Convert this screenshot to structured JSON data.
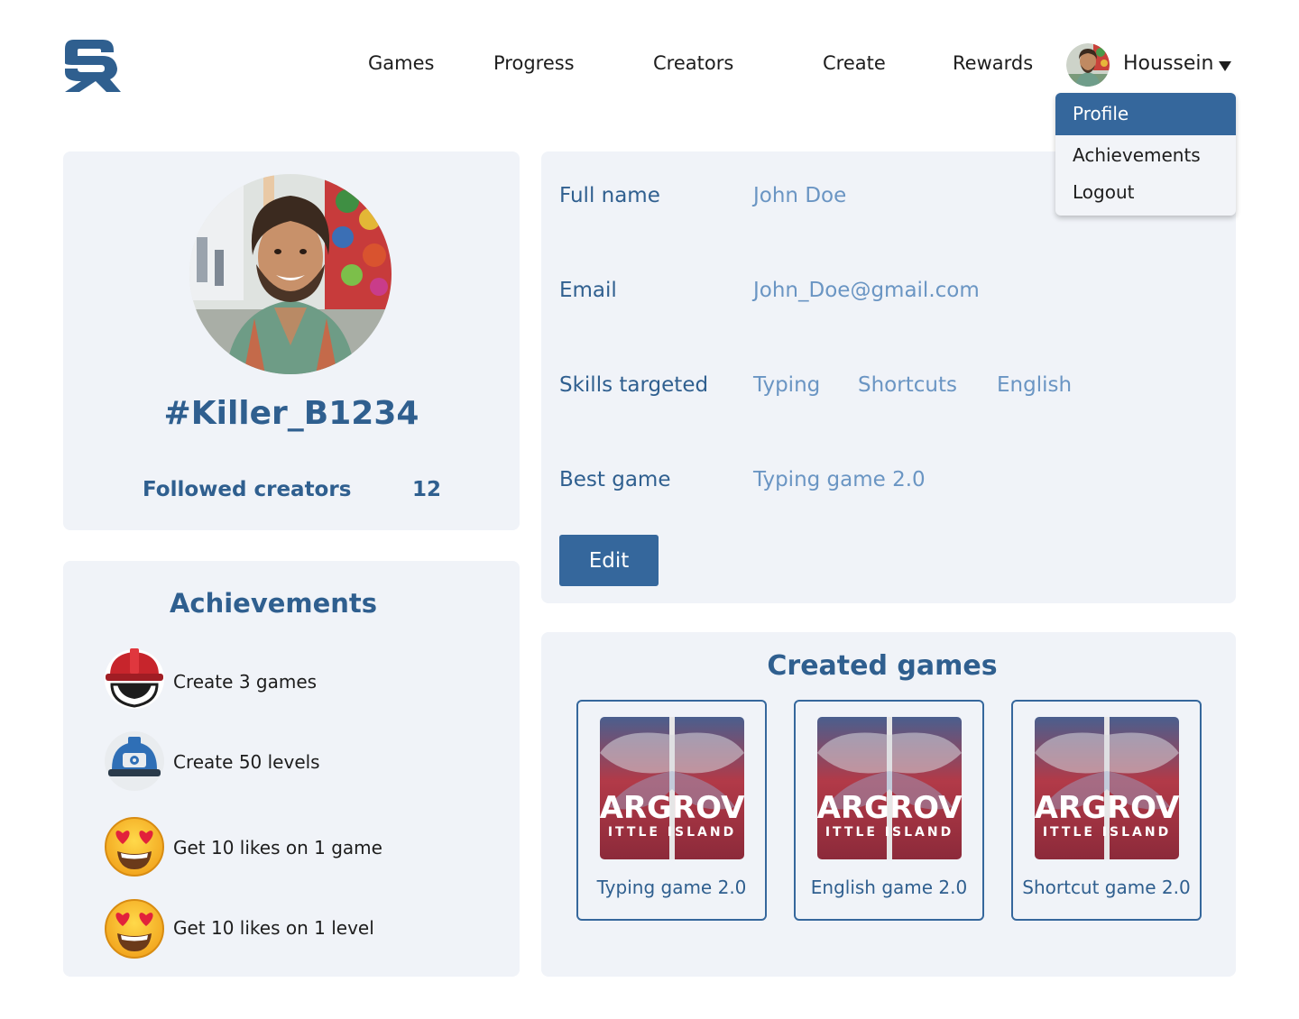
{
  "brand": {
    "logo_text": "SR",
    "logo_color": "#2f5f8f"
  },
  "nav": {
    "games": "Games",
    "progress": "Progress",
    "creators": "Creators",
    "create": "Create",
    "rewards": "Rewards"
  },
  "user_menu": {
    "name": "Houssein",
    "items": [
      "Profile",
      "Achievements",
      "Logout"
    ],
    "active_item": "Profile"
  },
  "profile": {
    "username": "#Killer_B1234",
    "followed_label": "Followed creators",
    "followed_count": "12"
  },
  "info": {
    "full_name_label": "Full name",
    "full_name": "John Doe",
    "email_label": "Email",
    "email": "John_Doe@gmail.com",
    "skills_label": "Skills targeted",
    "skills": [
      "Typing",
      "Shortcuts",
      "English"
    ],
    "best_game_label": "Best game",
    "best_game": "Typing game 2.0",
    "edit_label": "Edit"
  },
  "achievements": {
    "title": "Achievements",
    "items": [
      {
        "icon": "red-hard-hat-icon",
        "label": "Create 3 games"
      },
      {
        "icon": "blue-hard-hat-icon",
        "label": "Create 50 levels"
      },
      {
        "icon": "heart-eyes-emoji-icon",
        "label": "Get 10 likes on 1 game"
      },
      {
        "icon": "heart-eyes-emoji-icon",
        "label": "Get 10 likes on 1 level"
      }
    ]
  },
  "created_games": {
    "title": "Created games",
    "cover_text_1": "ARGROV",
    "cover_text_2": "ITTLE ISLAND",
    "games": [
      {
        "name": "Typing game 2.0"
      },
      {
        "name": "English game 2.0"
      },
      {
        "name": "Shortcut game 2.0"
      }
    ]
  },
  "colors": {
    "accent": "#35679c",
    "heading": "#2f5f8f",
    "value": "#6a95c3",
    "card_bg": "#f0f3f8"
  }
}
